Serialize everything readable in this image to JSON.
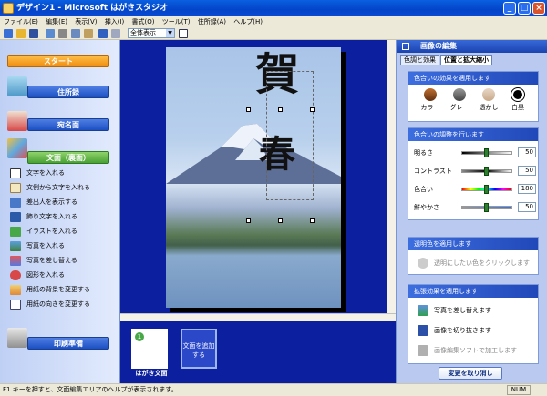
{
  "window": {
    "title": "デザイン1 - Microsoft はがきスタジオ",
    "minimize": "_",
    "maximize": "□",
    "close": "×"
  },
  "menu": [
    "ファイル(E)",
    "編集(E)",
    "表示(V)",
    "挿入(I)",
    "書式(O)",
    "ツール(T)",
    "住所録(A)",
    "ヘルプ(H)"
  ],
  "toolbar": {
    "zoom_value": "全体表示",
    "zoom_arrow": "▼"
  },
  "left": {
    "start": "スタート",
    "address_book": "住所録",
    "addressee_side": "宛名面",
    "text_side": "文面（裏面）",
    "tasks": [
      "文字を入れる",
      "文例から文字を入れる",
      "差出人を表示する",
      "飾り文字を入れる",
      "イラストを入れる",
      "写真を入れる",
      "写真を差し替える",
      "図形を入れる",
      "用紙の背景を変更する",
      "用紙の向きを変更する"
    ],
    "print_prep": "印刷準備"
  },
  "canvas": {
    "kanji_top": "賀",
    "kanji_bottom": "春"
  },
  "pages": {
    "page1_number": "1",
    "page1_label": "はがき文面",
    "add_label": "文面を追加する"
  },
  "right": {
    "title": "画像の編集",
    "tabs": [
      "色調と効果",
      "位置と拡大縮小"
    ],
    "color_effects": {
      "header": "色合いの効果を適用します",
      "items": [
        "カラー",
        "グレー",
        "透かし",
        "白黒"
      ]
    },
    "color_adjust": {
      "header": "色合いの調整を行います",
      "rows": [
        {
          "label": "明るさ",
          "value": "50",
          "level": 0.5
        },
        {
          "label": "コントラスト",
          "value": "50",
          "level": 0.5
        },
        {
          "label": "色合い",
          "value": "180",
          "level": 0.5
        },
        {
          "label": "鮮やかさ",
          "value": "50",
          "level": 0.5
        }
      ]
    },
    "transparency": {
      "header": "透明色を適用します",
      "hint": "透明にしたい色をクリックします"
    },
    "extended": {
      "header": "拡張効果を適用します",
      "items": [
        "写真を差し替えます",
        "画像を切り抜きます",
        "画像編集ソフトで加工します"
      ]
    },
    "undo": "変更を取り消し"
  },
  "status": {
    "text": "F1 キーを押すと、文面編集エリアのヘルプが表示されます。",
    "num": "NUM"
  },
  "colors": {
    "title_bar": "#0344c9",
    "canvas_bg": "#0c1f9e",
    "start_button": "#f08c10",
    "text_side_button": "#4aa136",
    "slider_knob": "#2f7d2f"
  }
}
